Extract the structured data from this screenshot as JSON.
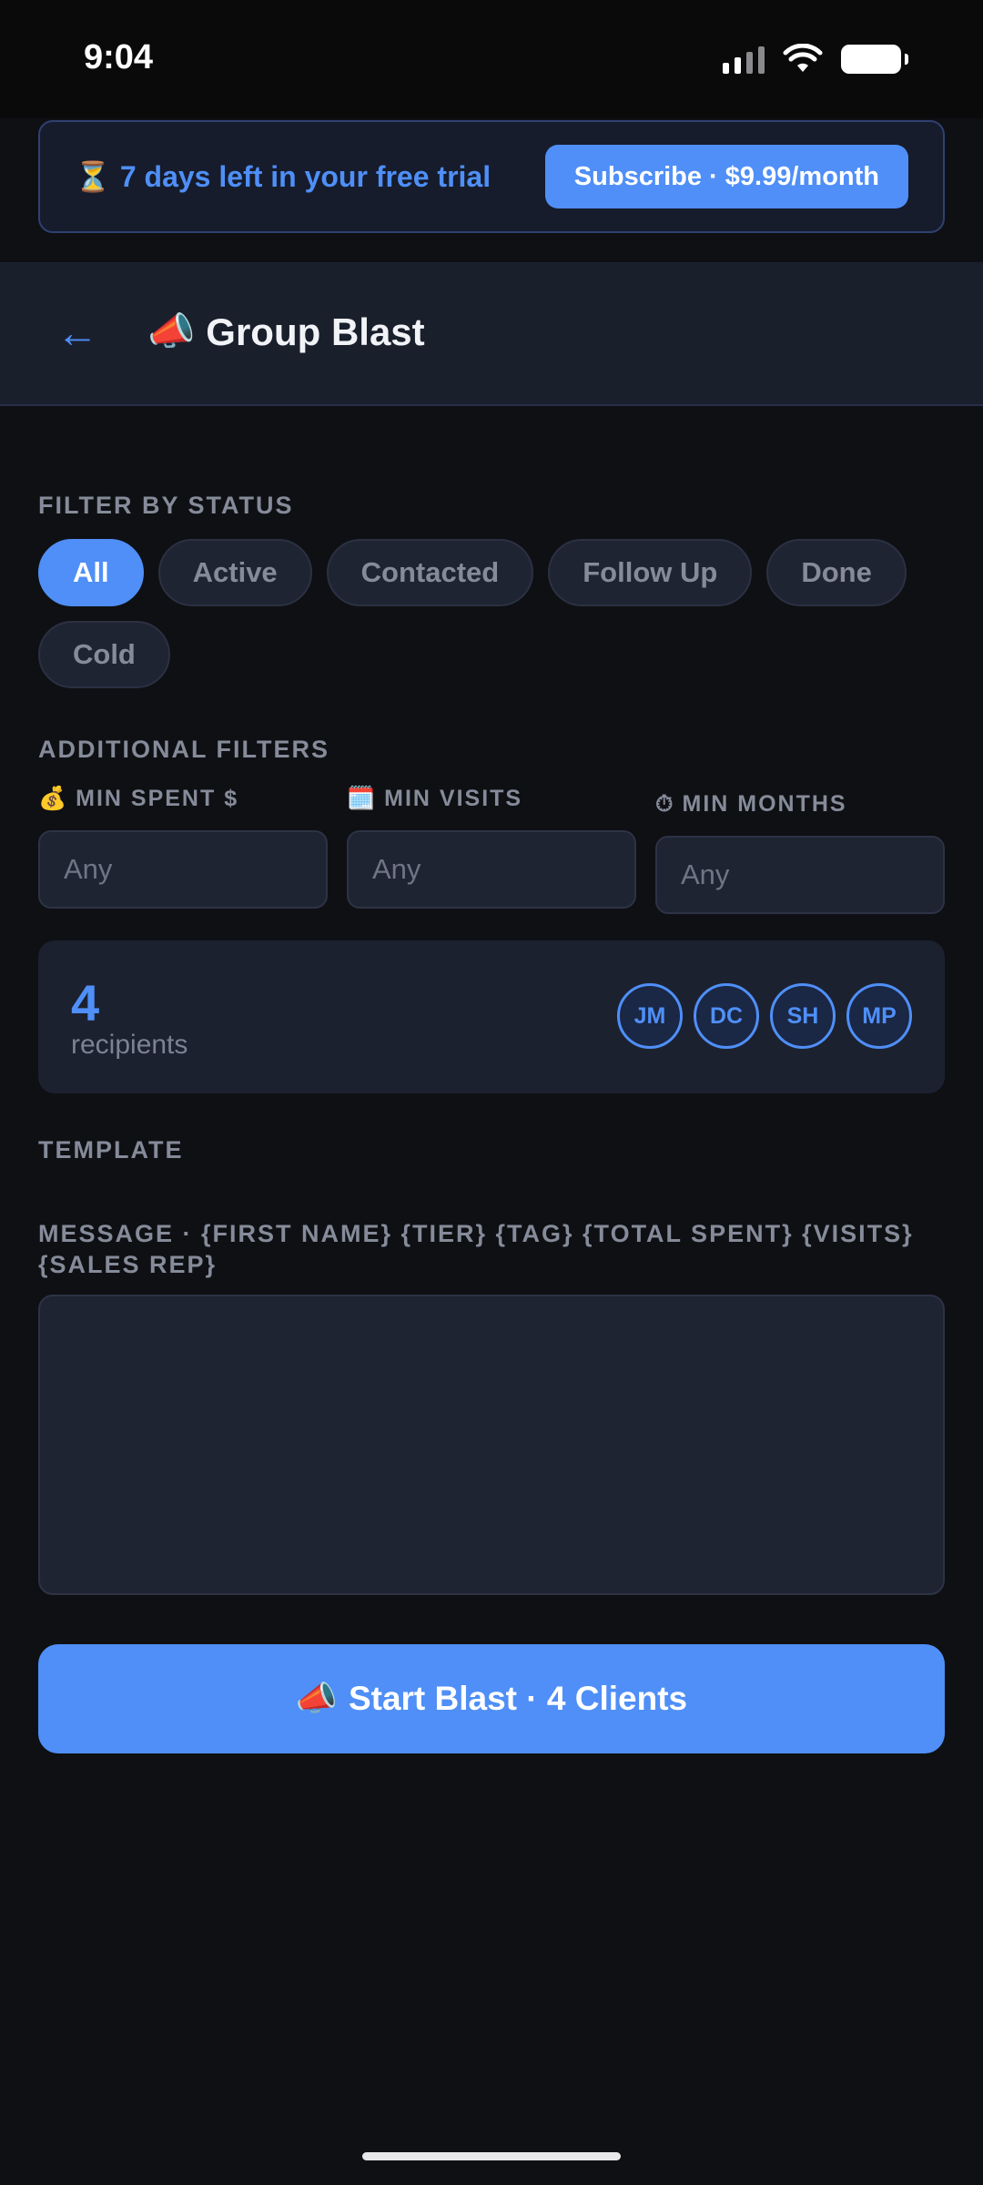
{
  "status_bar": {
    "time": "9:04"
  },
  "trial_banner": {
    "icon": "hourglass-icon",
    "emoji": "⏳",
    "text": "7 days left in your free trial",
    "subscribe_label": "Subscribe · $9.99/month"
  },
  "header": {
    "back_symbol": "←",
    "emoji": "📣",
    "title": "Group Blast"
  },
  "filter_status": {
    "label": "FILTER BY STATUS",
    "chips": [
      {
        "label": "All",
        "active": true
      },
      {
        "label": "Active",
        "active": false
      },
      {
        "label": "Contacted",
        "active": false
      },
      {
        "label": "Follow Up",
        "active": false
      },
      {
        "label": "Done",
        "active": false
      },
      {
        "label": "Cold",
        "active": false
      }
    ]
  },
  "additional_filters": {
    "label": "ADDITIONAL FILTERS",
    "min_spent": {
      "emoji": "💰",
      "label": "MIN SPENT $",
      "placeholder": "Any"
    },
    "min_visits": {
      "emoji": "🗓️",
      "label": "MIN VISITS",
      "placeholder": "Any"
    },
    "min_months": {
      "emoji": "⏱",
      "label": "MIN MONTHS",
      "placeholder": "Any"
    }
  },
  "recipients": {
    "count": "4",
    "label": "recipients",
    "avatars": [
      "JM",
      "DC",
      "SH",
      "MP"
    ]
  },
  "template": {
    "label": "TEMPLATE"
  },
  "message": {
    "label": "MESSAGE · {FIRST NAME} {TIER} {TAG} {TOTAL SPENT} {VISITS} {SALES REP}",
    "value": ""
  },
  "start_button": {
    "emoji": "📣",
    "label": "Start Blast · 4 Clients"
  },
  "colors": {
    "accent": "#4f8ff7",
    "background": "#0f1014",
    "card": "#1c2130"
  }
}
